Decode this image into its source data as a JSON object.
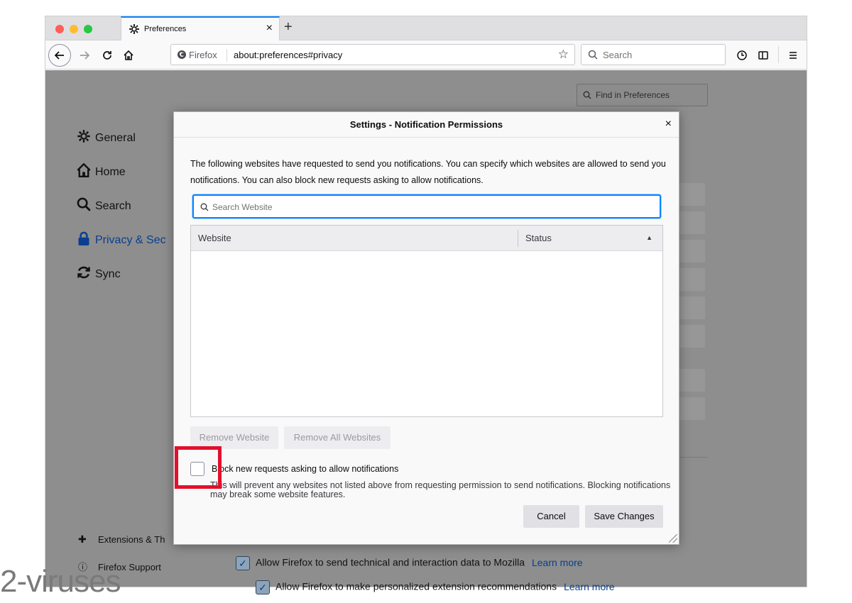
{
  "browser": {
    "tab": {
      "title": "Preferences",
      "close": "×"
    },
    "new_tab": "+",
    "urlbar": {
      "identity": "Firefox",
      "url": "about:preferences#privacy"
    },
    "searchbar": {
      "placeholder": "Search"
    }
  },
  "preferences": {
    "find_placeholder": "Find in Preferences",
    "categories": [
      {
        "label": "General",
        "icon": "gear-icon"
      },
      {
        "label": "Home",
        "icon": "home-icon"
      },
      {
        "label": "Search",
        "icon": "search-icon"
      },
      {
        "label": "Privacy & Sec",
        "icon": "lock-icon",
        "selected": true
      },
      {
        "label": "Sync",
        "icon": "sync-icon"
      }
    ],
    "footer": {
      "extensions": "Extensions & Th",
      "support": "Firefox Support"
    },
    "background_checks": [
      {
        "label": "Allow Firefox to send technical and interaction data to Mozilla",
        "learn_more": "Learn more",
        "checked": true
      },
      {
        "label": "Allow Firefox to make personalized extension recommendations",
        "learn_more": "Learn more",
        "checked": true
      }
    ]
  },
  "dialog": {
    "title": "Settings - Notification Permissions",
    "close": "×",
    "description": "The following websites have requested to send you notifications. You can specify which websites are allowed to send you notifications. You can also block new requests asking to allow notifications.",
    "search_placeholder": "Search Website",
    "table": {
      "columns": [
        "Website",
        "Status"
      ],
      "rows": []
    },
    "remove_website": "Remove Website",
    "remove_all_websites": "Remove All Websites",
    "block_checkbox": {
      "label": "Block new requests asking to allow notifications",
      "checked": false,
      "description": "This will prevent any websites not listed above from requesting permission to send notifications. Blocking notifications may break some website features."
    },
    "cancel": "Cancel",
    "save_changes": "Save Changes"
  },
  "watermark": "2-viruses",
  "colors": {
    "accent": "#0a84ff",
    "highlight": "#e3102b",
    "traffic_red": "#fe5f57",
    "traffic_yellow": "#febc2e",
    "traffic_green": "#28c840"
  }
}
